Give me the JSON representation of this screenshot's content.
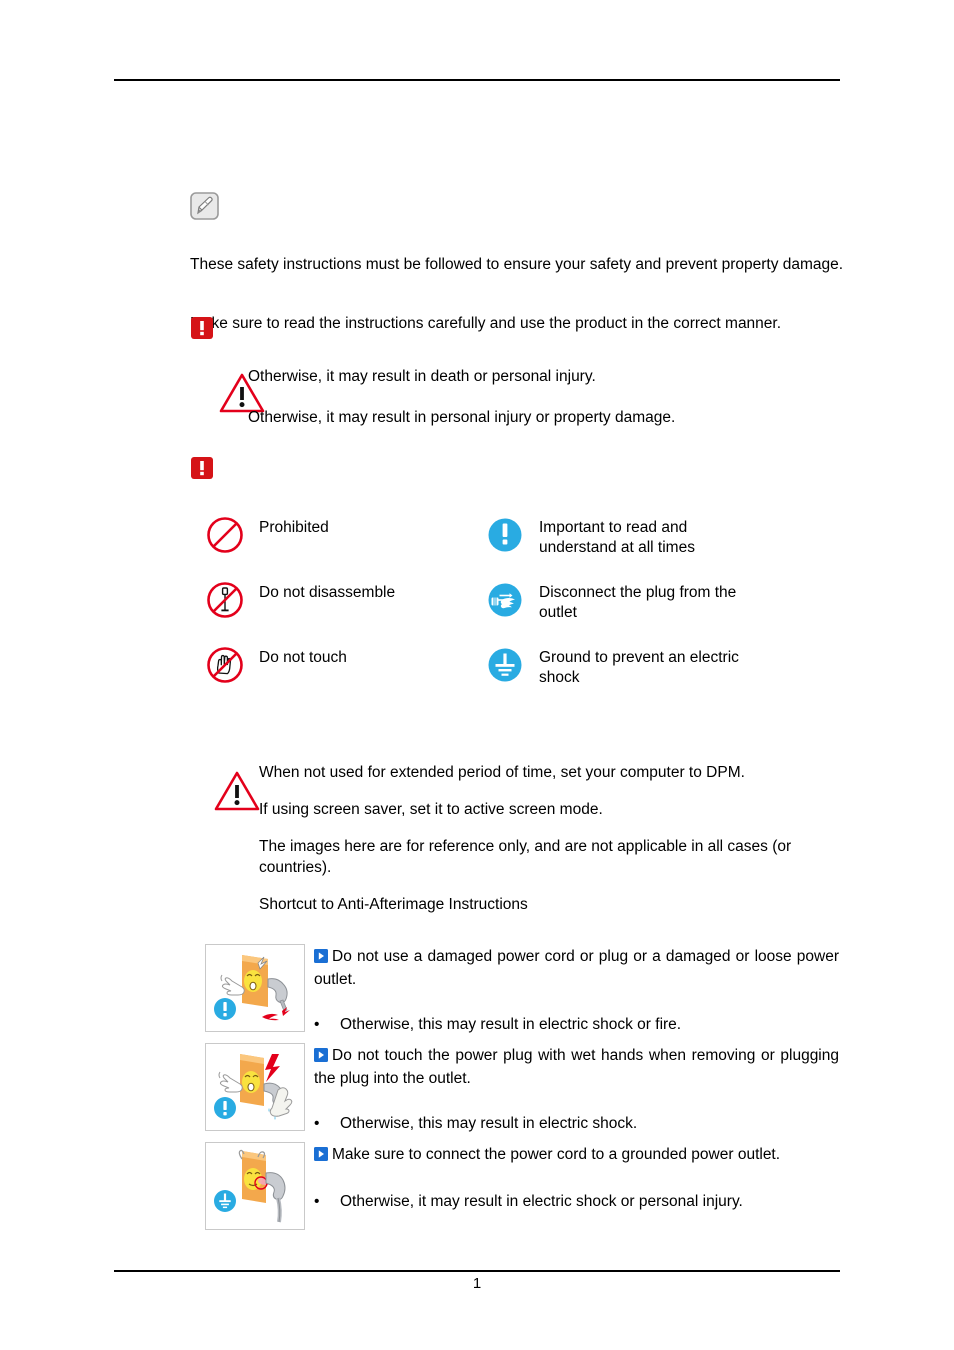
{
  "document": {
    "page_number": "1",
    "colors": {
      "alert_red": "#d51317",
      "triangle_red": "#e3001b",
      "icon_blue": "#29abe2",
      "marker_blue": "#1a6fd4",
      "note_gray": "#8c8c8c"
    }
  },
  "intro": {
    "note_icon": "memo-note-icon",
    "paragraph_1": "These safety instructions must be followed to ensure your safety and prevent property damage.",
    "paragraph_2": "Make sure to read the instructions carefully and use the product in the correct manner.",
    "alert_icon_1": "red-exclamation-icon",
    "alert_icon_2": "red-exclamation-icon"
  },
  "warning_block": {
    "icon": "warning-triangle-icon",
    "lines": [
      "Otherwise, it may result in death or personal injury.",
      "Otherwise, it may result in personal injury or property damage."
    ]
  },
  "legend": {
    "rows": [
      {
        "left": {
          "icon": "prohibited-icon",
          "label": "Prohibited"
        },
        "right": {
          "icon": "important-exclamation-icon",
          "label": "Important to read and understand at all times"
        }
      },
      {
        "left": {
          "icon": "do-not-disassemble-icon",
          "label": "Do not disassemble"
        },
        "right": {
          "icon": "disconnect-plug-icon",
          "label": "Disconnect the plug from the outlet"
        }
      },
      {
        "left": {
          "icon": "do-not-touch-icon",
          "label": "Do not touch"
        },
        "right": {
          "icon": "ground-earth-icon",
          "label": "Ground to prevent an electric shock"
        }
      }
    ]
  },
  "dpm_notice": {
    "icon": "warning-triangle-icon",
    "lines": [
      "When not used for extended period of time, set your computer to DPM.",
      "If using screen saver, set it to active screen mode.",
      "The images here are for reference only, and are not applicable in all cases (or countries).",
      "Shortcut to Anti-Afterimage Instructions"
    ]
  },
  "instructions": {
    "marker_icon": "blue-play-marker-icon",
    "rows": [
      {
        "thumb_name": "damaged-power-cord-illustration",
        "thumb_badge": "important-exclamation-icon",
        "title": "Do not use a damaged power cord or plug or a damaged or loose power outlet.",
        "bullet_dot": "•",
        "bullet": "Otherwise, this may result in electric shock or fire."
      },
      {
        "thumb_name": "wet-hands-plug-illustration",
        "thumb_badge": "important-exclamation-icon",
        "title": "Do not touch the power plug with wet hands when removing or plugging the plug into the outlet.",
        "bullet_dot": "•",
        "bullet": "Otherwise, this may result in electric shock."
      },
      {
        "thumb_name": "grounded-outlet-illustration",
        "thumb_badge": "ground-earth-icon",
        "title": "Make sure to connect the power cord to a grounded power outlet.",
        "bullet_dot": "•",
        "bullet": "Otherwise, it may result in electric shock or personal injury."
      }
    ]
  }
}
